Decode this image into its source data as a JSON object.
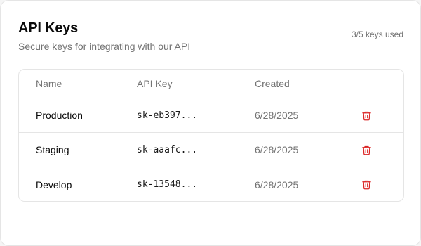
{
  "header": {
    "title": "API Keys",
    "subtitle": "Secure keys for integrating with our API",
    "usage": "3/5 keys used"
  },
  "table": {
    "columns": {
      "name": "Name",
      "key": "API Key",
      "created": "Created"
    },
    "rows": [
      {
        "name": "Production",
        "key": "sk-eb397...",
        "created": "6/28/2025",
        "action_icon": "trash-icon"
      },
      {
        "name": "Staging",
        "key": "sk-aaafc...",
        "created": "6/28/2025",
        "action_icon": "trash-icon"
      },
      {
        "name": "Develop",
        "key": "sk-13548...",
        "created": "6/28/2025",
        "action_icon": "trash-icon"
      }
    ]
  },
  "colors": {
    "danger": "#dc2626",
    "muted_text": "#737373",
    "border": "#e5e5e5"
  }
}
